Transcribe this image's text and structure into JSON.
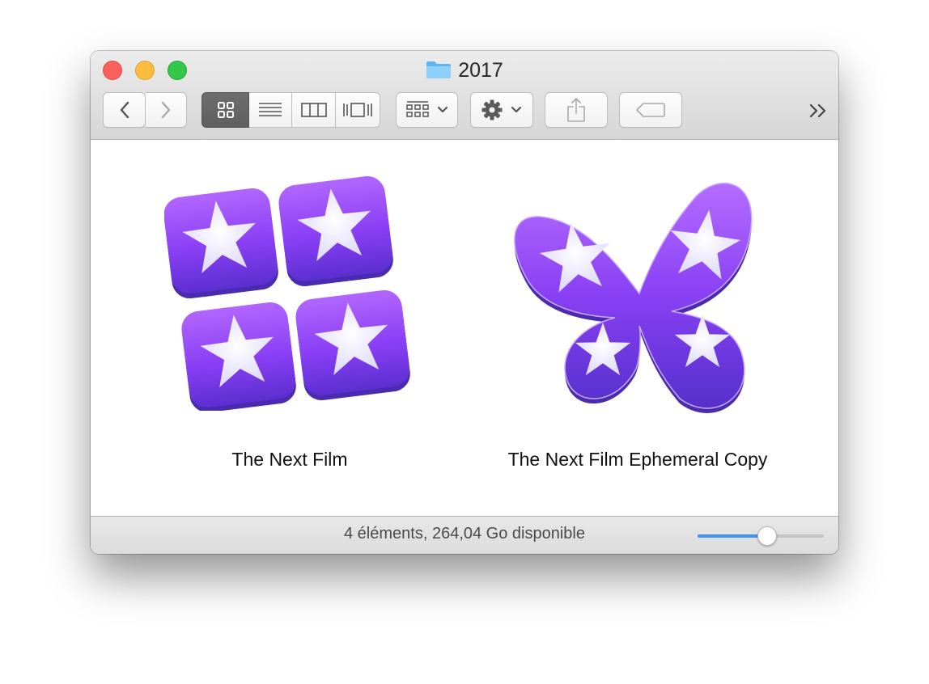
{
  "window": {
    "title": "2017",
    "title_icon": "folder-icon"
  },
  "toolbar": {
    "back_icon": "chevron-left-icon",
    "forward_icon": "chevron-right-icon",
    "view_modes": [
      "icon-view",
      "list-view",
      "column-view",
      "cover-flow-view"
    ],
    "active_view": "icon-view",
    "arrange_icon": "arrange-grid-icon",
    "action_icon": "gear-icon",
    "share_icon": "share-icon",
    "tags_icon": "tag-icon",
    "overflow_label": ">>"
  },
  "files": [
    {
      "name": "The Next Film",
      "icon": "imovie-library-icon"
    },
    {
      "name": "The Next Film Ephemeral Copy",
      "icon": "imovie-butterfly-icon"
    }
  ],
  "statusbar": {
    "text": "4 éléments, 264,04 Go disponible"
  },
  "icon_size_slider": {
    "level": 0.55
  },
  "colors": {
    "accent": "#3f93f8",
    "close": "#fc605c",
    "minimize": "#fdbc40",
    "zoom": "#34c84a",
    "icon_purple": "#7b3ff0"
  }
}
